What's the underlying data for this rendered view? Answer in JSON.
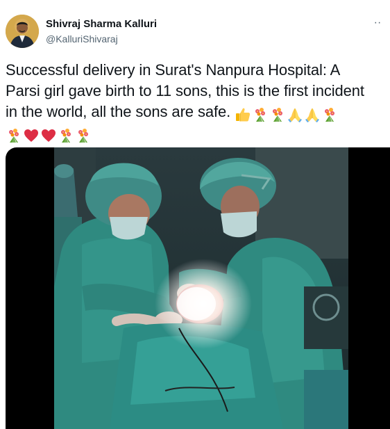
{
  "user": {
    "display_name": "Shivraj Sharma Kalluri",
    "handle": "@KalluriShivaraj"
  },
  "tweet": {
    "line1": "Successful delivery in Surat's Nanpura Hospital: A",
    "line2": "Parsi girl gave birth to 11 sons, this is the first incident",
    "line3": "in the world, all the sons are safe.",
    "emojis_line3": [
      "thumbs-up",
      "bouquet",
      "bouquet",
      "folded-hands",
      "folded-hands",
      "bouquet"
    ],
    "emojis_line4": [
      "bouquet",
      "red-heart",
      "red-heart",
      "bouquet",
      "bouquet"
    ]
  },
  "more_menu": {
    "label": "··"
  },
  "colors": {
    "text": "#0f1419",
    "secondary": "#536471",
    "scrubs": "#2f8f86"
  }
}
